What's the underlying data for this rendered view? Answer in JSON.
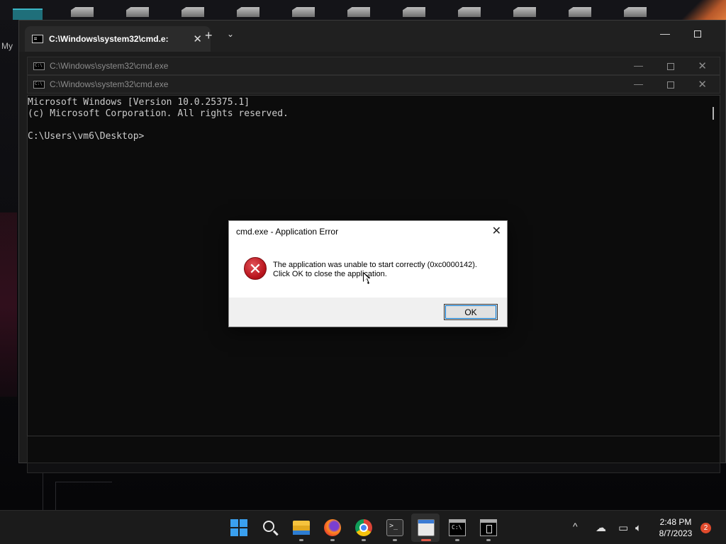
{
  "desktop": {
    "label_fragment": "My"
  },
  "terminal": {
    "tab_title": "C:\\Windows\\system32\\cmd.e:",
    "tab_close": "✕",
    "add_tab": "+",
    "dropdown": "⌄",
    "minimize": "—"
  },
  "cmd_windows": [
    {
      "title": "C:\\Windows\\system32\\cmd.exe",
      "minimize": "—",
      "close": "✕"
    },
    {
      "title": "C:\\Windows\\system32\\cmd.exe",
      "minimize": "—",
      "close": "✕"
    }
  ],
  "console": {
    "text": "Microsoft Windows [Version 10.0.25375.1]\n(c) Microsoft Corporation. All rights reserved.\n\nC:\\Users\\vm6\\Desktop>"
  },
  "dialog": {
    "title": "cmd.exe - Application Error",
    "close": "✕",
    "icon": "error-x-icon",
    "icon_glyph": "✕",
    "message_line1": "The application was unable to start correctly (0xc0000142).",
    "message_line2": "Click OK to close the application.",
    "ok_label": "OK"
  },
  "taskbar": {
    "apps": [
      "start-icon",
      "search-icon",
      "file-explorer-icon",
      "firefox-icon",
      "chrome-icon",
      "terminal-icon",
      "notepad-icon",
      "cmd-icon",
      "cmd-window-icon"
    ],
    "tray_chevron": "^",
    "tray_icons": [
      "onedrive-icon",
      "network-icon",
      "volume-icon"
    ],
    "time": "2:48 PM",
    "date": "8/7/2023",
    "notification_count": "2"
  },
  "colors": {
    "accent": "#0078d7",
    "error_red": "#b8141c",
    "windows_blue": "#3aa0ef"
  }
}
